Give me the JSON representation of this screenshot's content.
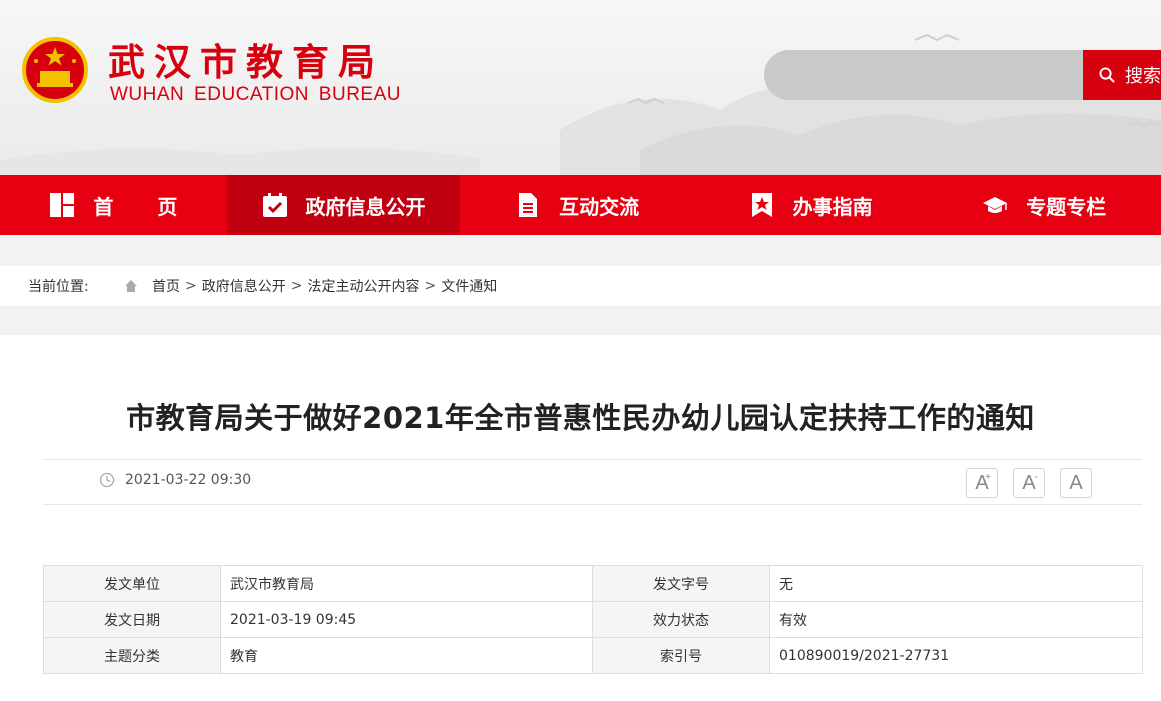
{
  "header": {
    "title": "武汉市教育局",
    "subtitle": "WUHAN EDUCATION BUREAU",
    "search_placeholder": "",
    "search_button": "搜索"
  },
  "nav": {
    "items": [
      {
        "label": "首页",
        "icon": "home-grid-icon"
      },
      {
        "label": "政府信息公开",
        "icon": "calendar-check-icon"
      },
      {
        "label": "互动交流",
        "icon": "document-icon"
      },
      {
        "label": "办事指南",
        "icon": "bookmark-star-icon"
      },
      {
        "label": "专题专栏",
        "icon": "graduation-cap-icon"
      }
    ],
    "active_index": 1
  },
  "breadcrumb": {
    "label": "当前位置:",
    "items": [
      "首页",
      "政府信息公开",
      "法定主动公开内容",
      "文件通知"
    ],
    "separator": ">"
  },
  "article": {
    "title": "市教育局关于做好2021年全市普惠性民办幼儿园认定扶持工作的通知",
    "date": "2021-03-22 09:30",
    "font_buttons": [
      {
        "label": "A",
        "mark": "+"
      },
      {
        "label": "A",
        "mark": "-"
      },
      {
        "label": "A",
        "mark": ""
      }
    ]
  },
  "info_table": {
    "rows": [
      {
        "k1": "发文单位",
        "v1": "武汉市教育局",
        "k2": "发文字号",
        "v2": "无"
      },
      {
        "k1": "发文日期",
        "v1": "2021-03-19 09:45",
        "k2": "效力状态",
        "v2": "有效"
      },
      {
        "k1": "主题分类",
        "v1": "教育",
        "k2": "索引号",
        "v2": "010890019/2021-27731"
      }
    ]
  },
  "colors": {
    "brand_red": "#d7000f",
    "nav_red": "#e60012",
    "nav_active": "#c00010"
  }
}
